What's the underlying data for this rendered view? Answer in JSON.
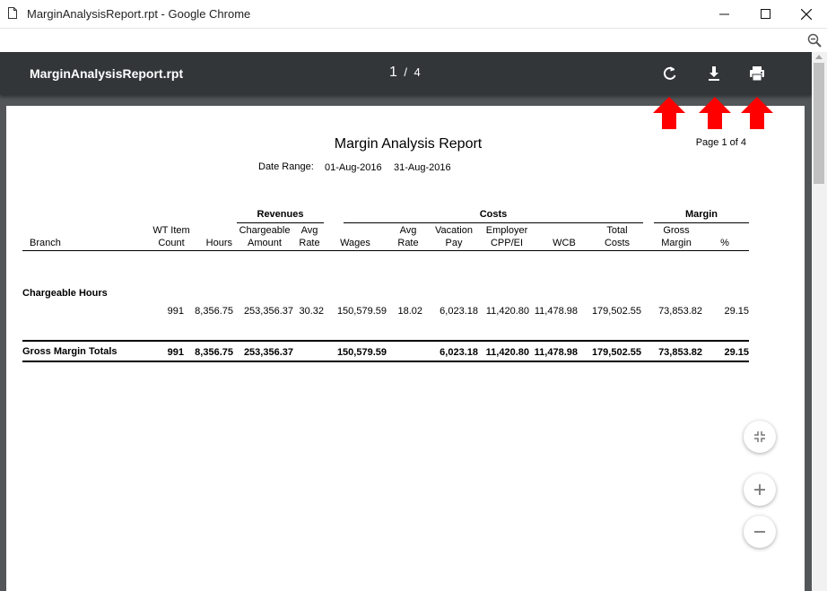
{
  "window": {
    "title": "MarginAnalysisReport.rpt - Google Chrome",
    "minimize": "–",
    "maximize": "☐",
    "close": "✕"
  },
  "viewer": {
    "filename": "MarginAnalysisReport.rpt",
    "current_page": "1",
    "separator": "/",
    "total_pages": "4",
    "icons": [
      "rotate-icon",
      "download-icon",
      "print-icon",
      "zoom-out-icon",
      "fit-page-icon",
      "zoom-in-icon"
    ]
  },
  "report": {
    "title": "Margin Analysis Report",
    "page_label": "Page 1 of 4",
    "date_range_label": "Date Range:",
    "date_from": "01-Aug-2016",
    "date_to": "31-Aug-2016",
    "groups": {
      "revenues": "Revenues",
      "costs": "Costs",
      "margin": "Margin"
    },
    "columns": {
      "branch": "Branch",
      "wt_item_count_1": "WT Item",
      "wt_item_count_2": "Count",
      "hours": "Hours",
      "chargeable_amount_1": "Chargeable",
      "chargeable_amount_2": "Amount",
      "avg_rate_1": "Avg",
      "avg_rate_2": "Rate",
      "wages": "Wages",
      "cost_avg_rate_1": "Avg",
      "cost_avg_rate_2": "Rate",
      "vacation_pay_1": "Vacation",
      "vacation_pay_2": "Pay",
      "employer_1": "Employer",
      "employer_2": "CPP/EI",
      "wcb": "WCB",
      "total_costs_1": "Total",
      "total_costs_2": "Costs",
      "gross_margin_1": "Gross",
      "gross_margin_2": "Margin",
      "pct": "%"
    },
    "section_label": "Chargeable Hours",
    "row": {
      "count": "991",
      "hours": "8,356.75",
      "amount": "253,356.37",
      "avg_rate": "30.32",
      "wages": "150,579.59",
      "cost_avg_rate": "18.02",
      "vacation": "6,023.18",
      "employer": "11,420.80",
      "wcb": "11,478.98",
      "total_costs": "179,502.55",
      "gross_margin": "73,853.82",
      "pct": "29.15"
    },
    "totals": {
      "label": "Gross Margin Totals",
      "count": "991",
      "hours": "8,356.75",
      "amount": "253,356.37",
      "wages": "150,579.59",
      "vacation": "6,023.18",
      "employer": "11,420.80",
      "wcb": "11,478.98",
      "total_costs": "179,502.55",
      "gross_margin": "73,853.82",
      "pct": "29.15"
    }
  },
  "colors": {
    "toolbar": "#323639",
    "viewer_bg": "#525659",
    "arrow": "#ff0000"
  }
}
